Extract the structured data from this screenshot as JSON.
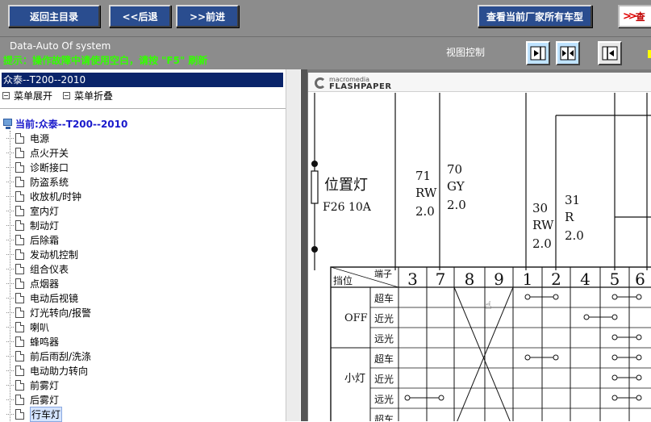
{
  "toolbar": {
    "back_main_label": "返回主目录",
    "back_label": "<<后退",
    "forward_label": ">>前进",
    "view_models_label": "查看当前厂家所有车型",
    "partial_label": "查"
  },
  "status": {
    "system_title": "Data-Auto Of system",
    "hint": "提示：操作故障中请使用空白，请按 \"F5\" 刷新",
    "view_control_label": "视图控制"
  },
  "tree": {
    "selected_header": "众泰--T200--2010",
    "expand_label": "菜单展开",
    "collapse_label": "菜单折叠",
    "root_label": "当前:众泰--T200--2010",
    "items": [
      {
        "label": "电源"
      },
      {
        "label": "点火开关"
      },
      {
        "label": "诊断接口"
      },
      {
        "label": "防盗系统"
      },
      {
        "label": "收放机/时钟"
      },
      {
        "label": "室内灯"
      },
      {
        "label": "制动灯"
      },
      {
        "label": "后除霜"
      },
      {
        "label": "发动机控制"
      },
      {
        "label": "组合仪表"
      },
      {
        "label": "点烟器"
      },
      {
        "label": "电动后视镜"
      },
      {
        "label": "灯光转向/报警"
      },
      {
        "label": "喇叭"
      },
      {
        "label": "蜂鸣器"
      },
      {
        "label": "前后雨刮/洗涤"
      },
      {
        "label": "电动助力转向"
      },
      {
        "label": "前雾灯"
      },
      {
        "label": "后雾灯"
      },
      {
        "label": "行车灯",
        "selected": true
      }
    ]
  },
  "viewer": {
    "brand": "macromedia",
    "product": "FLASHPAPER",
    "diagram": {
      "fuse_label": "位置灯",
      "fuse_spec": "F26 10A",
      "wires": [
        {
          "num": "71",
          "color": "RW",
          "size": "2.0"
        },
        {
          "num": "70",
          "color": "GY",
          "size": "2.0"
        },
        {
          "num": "30",
          "color": "RW",
          "size": "2.0"
        },
        {
          "num": "31",
          "color": "R",
          "size": "2.0"
        }
      ],
      "table_header_position": "挡位",
      "table_header_terminal": "端子",
      "terminals": [
        "3",
        "7",
        "8",
        "9",
        "1",
        "2",
        "4",
        "5",
        "6"
      ],
      "rows": [
        {
          "group": "OFF",
          "sub": "超车"
        },
        {
          "group": "",
          "sub": "近光"
        },
        {
          "group": "",
          "sub": "远光"
        },
        {
          "group": "小灯",
          "sub": "超车"
        },
        {
          "group": "",
          "sub": "近光"
        },
        {
          "group": "",
          "sub": "远光"
        },
        {
          "group": "",
          "sub": "超车"
        }
      ]
    }
  }
}
